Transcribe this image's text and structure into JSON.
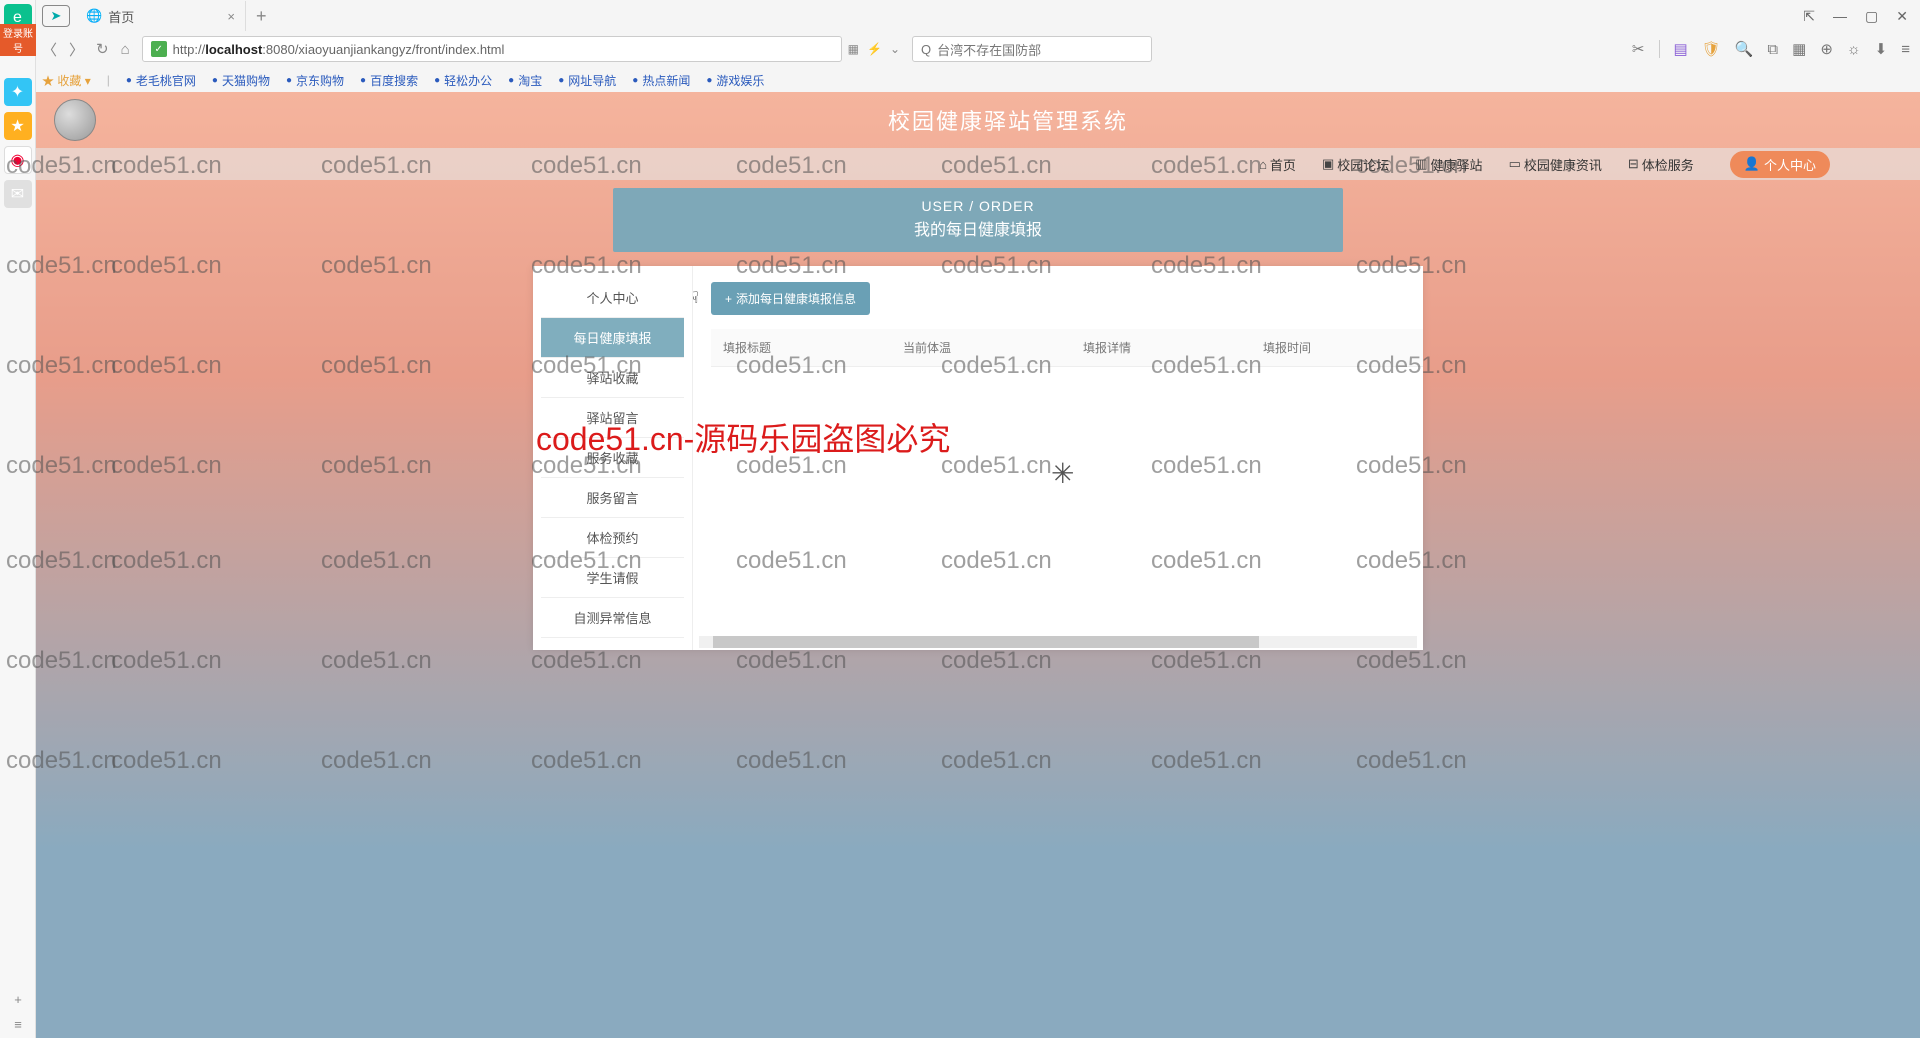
{
  "browser": {
    "tab_title": "首页",
    "url_prefix": "http://",
    "url_host": "localhost",
    "url_rest": ":8080/xiaoyuanjiankangyz/front/index.html",
    "search_placeholder": "台湾不存在国防部",
    "bookmarks_label": "收藏",
    "bookmarks": [
      "老毛桃官网",
      "天猫购物",
      "京东购物",
      "百度搜索",
      "轻松办公",
      "淘宝",
      "网址导航",
      "热点新闻",
      "游戏娱乐"
    ],
    "login_tag": "登录账号"
  },
  "app": {
    "title": "校园健康驿站管理系统",
    "nav": [
      {
        "icon": "⌂",
        "label": "首页"
      },
      {
        "icon": "▣",
        "label": "校园论坛"
      },
      {
        "icon": "▥",
        "label": "健康驿站"
      },
      {
        "icon": "▭",
        "label": "校园健康资讯"
      },
      {
        "icon": "⊟",
        "label": "体检服务"
      }
    ],
    "user_center": "个人中心",
    "hero_en": "USER / ORDER",
    "hero_cn": "我的每日健康填报",
    "side_menu": [
      "个人中心",
      "每日健康填报",
      "驿站收藏",
      "驿站留言",
      "服务收藏",
      "服务留言",
      "体检预约",
      "学生请假",
      "自测异常信息"
    ],
    "side_menu_active": 1,
    "add_button": "添加每日健康填报信息",
    "table_headers": [
      "填报标题",
      "当前体温",
      "填报详情",
      "填报时间"
    ]
  },
  "watermark": {
    "text": "code51.cn",
    "red": "code51.cn-源码乐园盗图必究"
  }
}
